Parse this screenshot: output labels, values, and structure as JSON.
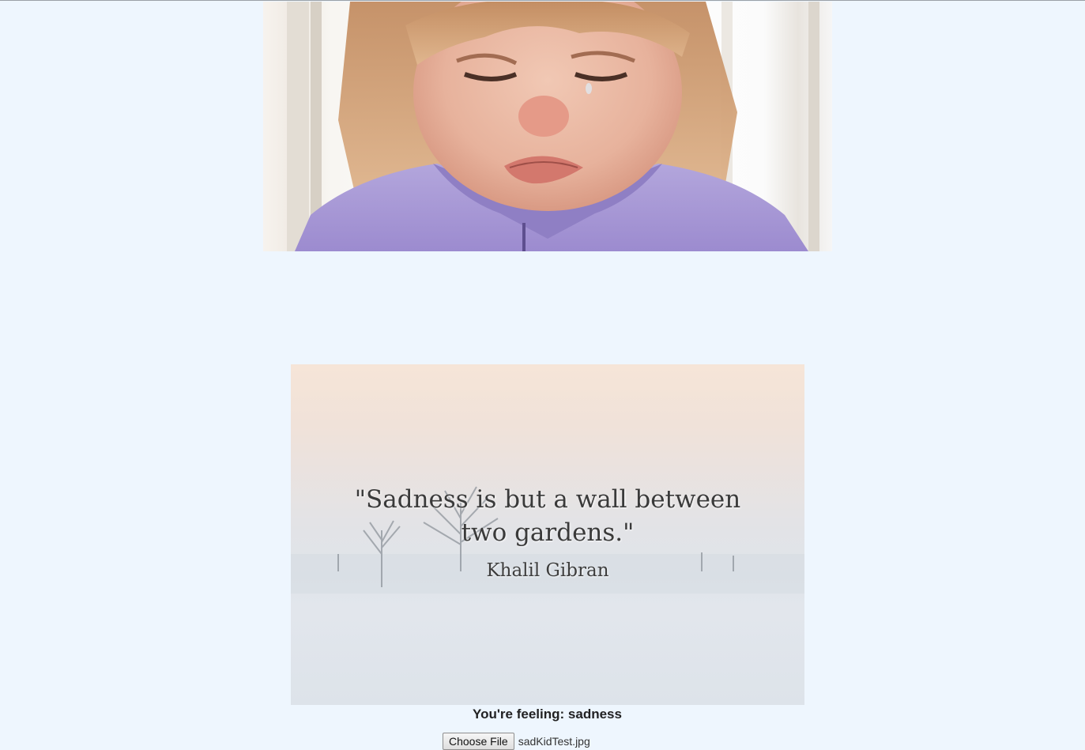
{
  "photo": {
    "alt": "crying child in purple sweater"
  },
  "quote_card": {
    "quote": "\"Sadness is but a wall between\ntwo gardens.\"",
    "author": "Khalil Gibran"
  },
  "result": {
    "prefix": "You're feeling: ",
    "emotion": "sadness"
  },
  "file_input": {
    "button_label": "Choose File",
    "file_name": "sadKidTest.jpg"
  },
  "colors": {
    "page_background": "#eef6fe",
    "sweater": "#a99ad6",
    "quote_text": "#3a3a3a"
  }
}
